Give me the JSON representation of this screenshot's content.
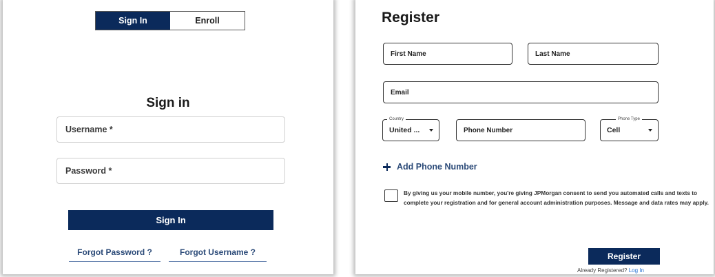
{
  "signin": {
    "tabs": [
      {
        "label": "Sign In",
        "active": true
      },
      {
        "label": "Enroll",
        "active": false
      }
    ],
    "title": "Sign in",
    "username_placeholder": "Username *",
    "password_placeholder": "Password *",
    "signin_button": "Sign In",
    "forgot_password": "Forgot Password ?",
    "forgot_username": "Forgot Username ?"
  },
  "register": {
    "title": "Register",
    "first_name_placeholder": "First Name",
    "last_name_placeholder": "Last Name",
    "email_placeholder": "Email",
    "country": {
      "label": "Country",
      "value": "United ..."
    },
    "phone_number_placeholder": "Phone Number",
    "phone_type": {
      "label": "Phone Type",
      "value": "Cell"
    },
    "add_phone": "Add Phone Number",
    "consent_text": "By giving us your mobile number, you're giving JPMorgan consent to send you automated calls and texts to complete your registration and for general account administration purposes. Message and data rates may apply.",
    "register_button": "Register",
    "already_registered": "Already Registered?",
    "login_link": "Log In"
  },
  "colors": {
    "primary": "#0b2a5b",
    "link": "#2b4a78",
    "login_link": "#1f6fd1"
  },
  "icons": [
    "plus-icon",
    "chevron-down-icon"
  ]
}
